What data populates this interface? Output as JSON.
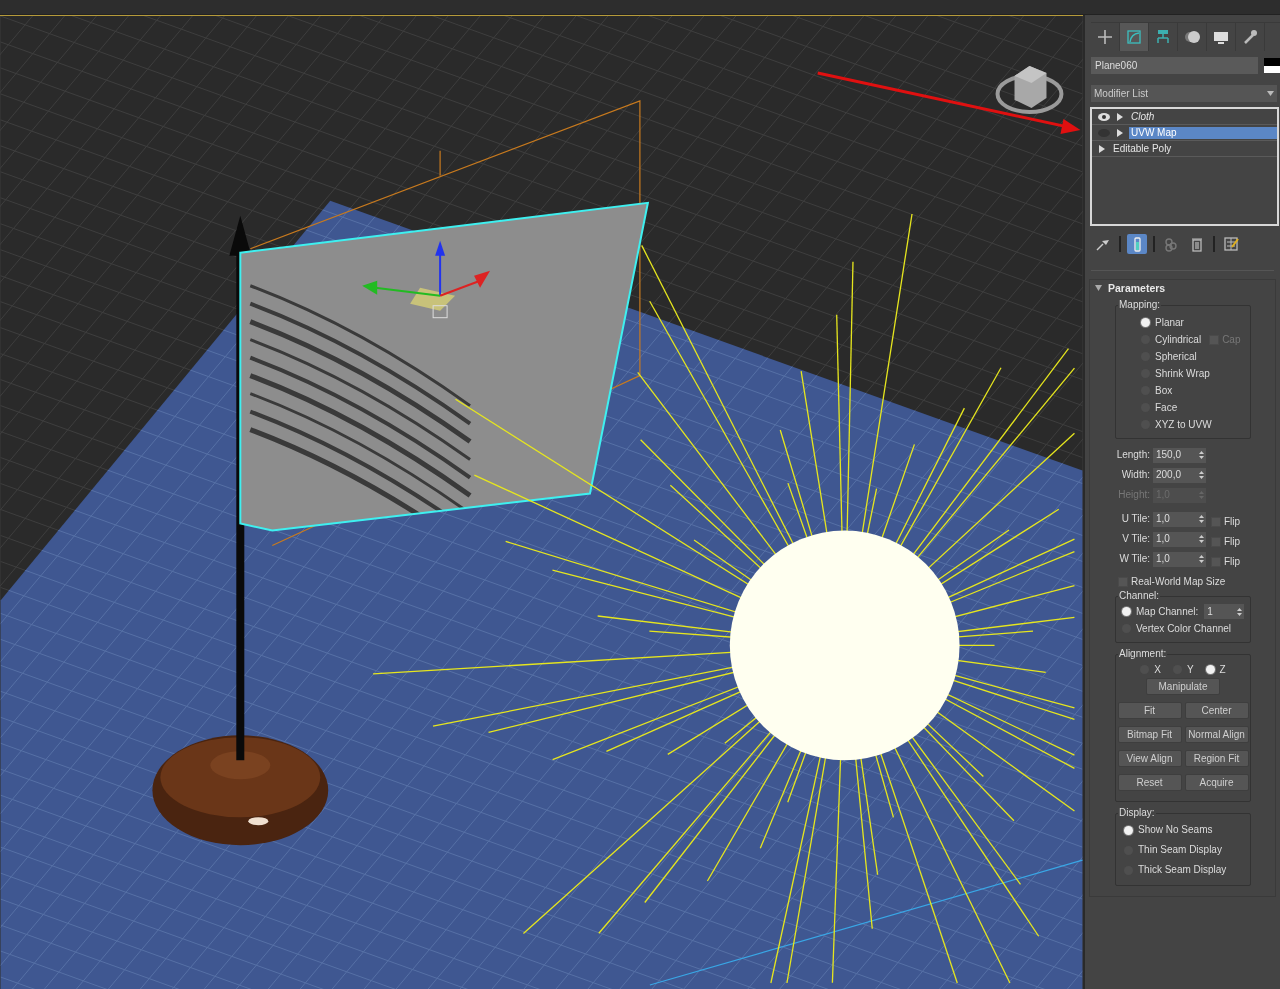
{
  "command_panel": {
    "tabs": [
      {
        "kind": "create",
        "selected": false
      },
      {
        "kind": "modify",
        "selected": true
      },
      {
        "kind": "hierarchy",
        "selected": false
      },
      {
        "kind": "motion",
        "selected": false
      },
      {
        "kind": "display",
        "selected": false
      },
      {
        "kind": "utilities",
        "selected": false
      }
    ],
    "object_name": "Plane060",
    "modifier_list": "Modifier List",
    "stack": [
      {
        "label": "Cloth",
        "kind": "modifier",
        "enabled": true,
        "italic": true,
        "selected": false
      },
      {
        "label": "UVW Map",
        "kind": "modifier",
        "enabled": false,
        "italic": false,
        "selected": true
      },
      {
        "label": "Editable Poly",
        "kind": "base",
        "italic": false,
        "selected": false
      }
    ],
    "stack_tools": [
      {
        "kind": "pin",
        "selected": false
      },
      {
        "kind": "show_end_result",
        "selected": true
      },
      {
        "kind": "make_unique",
        "selected": false
      },
      {
        "kind": "remove",
        "selected": false
      },
      {
        "kind": "configure",
        "selected": false
      }
    ],
    "rollout": {
      "title": "Parameters",
      "expanded": true,
      "mapping": {
        "legend": "Mapping:",
        "options": [
          {
            "label": "Planar",
            "selected": true
          },
          {
            "label": "Cylindrical",
            "selected": false,
            "cap": {
              "label": "Cap",
              "checked": false,
              "disabled": true
            }
          },
          {
            "label": "Spherical",
            "selected": false
          },
          {
            "label": "Shrink Wrap",
            "selected": false
          },
          {
            "label": "Box",
            "selected": false
          },
          {
            "label": "Face",
            "selected": false
          },
          {
            "label": "XYZ to UVW",
            "selected": false
          }
        ]
      },
      "size": [
        {
          "label": "Length:",
          "value": "150,0",
          "disabled": false
        },
        {
          "label": "Width:",
          "value": "200,0",
          "disabled": false
        },
        {
          "label": "Height:",
          "value": "1,0",
          "disabled": true
        }
      ],
      "tiles": [
        {
          "label": "U Tile:",
          "value": "1,0",
          "flip": {
            "label": "Flip",
            "checked": false
          }
        },
        {
          "label": "V Tile:",
          "value": "1,0",
          "flip": {
            "label": "Flip",
            "checked": false
          }
        },
        {
          "label": "W Tile:",
          "value": "1,0",
          "flip": {
            "label": "Flip",
            "checked": false
          }
        }
      ],
      "real_world": {
        "label": "Real-World Map Size",
        "checked": false
      },
      "channel": {
        "legend": "Channel:",
        "options": [
          {
            "label": "Map Channel:",
            "selected": true,
            "spinner": "1"
          },
          {
            "label": "Vertex Color Channel",
            "selected": false
          }
        ]
      },
      "alignment": {
        "legend": "Alignment:",
        "axes": [
          {
            "label": "X",
            "selected": false
          },
          {
            "label": "Y",
            "selected": false
          },
          {
            "label": "Z",
            "selected": true
          }
        ],
        "manipulate": "Manipulate",
        "buttons": [
          "Fit",
          "Center",
          "Bitmap Fit",
          "Normal Align",
          "View Align",
          "Region Fit",
          "Reset",
          "Acquire"
        ]
      },
      "display": {
        "legend": "Display:",
        "options": [
          {
            "label": "Show No Seams",
            "selected": true
          },
          {
            "label": "Thin Seam Display",
            "selected": false
          },
          {
            "label": "Thick Seam Display",
            "selected": false
          }
        ]
      }
    }
  }
}
